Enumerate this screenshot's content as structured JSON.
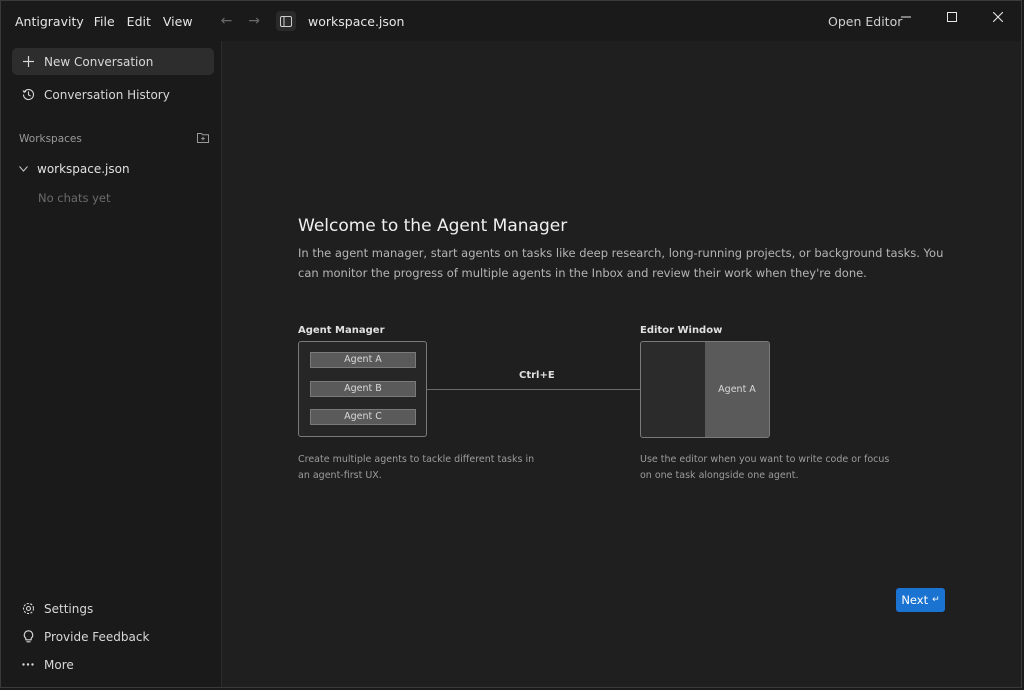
{
  "titlebar": {
    "app_name": "Antigravity",
    "menu": [
      "File",
      "Edit",
      "View"
    ],
    "title": "workspace.json",
    "open_editor": "Open Editor",
    "back_icon": "←",
    "forward_icon": "→"
  },
  "sidebar": {
    "new_conversation": "New Conversation",
    "conversation_history": "Conversation History",
    "workspaces_label": "Workspaces",
    "workspace_name": "workspace.json",
    "no_chats": "No chats yet",
    "settings": "Settings",
    "feedback": "Provide Feedback",
    "more": "More"
  },
  "main": {
    "title": "Welcome to the Agent Manager",
    "description": "In the agent manager, start agents on tasks like deep research, long-running projects, or background tasks. You can monitor the progress of multiple agents in the Inbox and review their work when they're done.",
    "manager_label": "Agent Manager",
    "agents": [
      "Agent A",
      "Agent B",
      "Agent C"
    ],
    "shortcut": "Ctrl+E",
    "editor_label": "Editor Window",
    "editor_agent": "Agent A",
    "manager_caption": "Create multiple agents to tackle different tasks in an agent-first UX.",
    "editor_caption": "Use the editor when you want to write code or focus on one task alongside one agent.",
    "next_label": "Next",
    "next_icon": "↵"
  },
  "colors": {
    "accent": "#1a73d1",
    "background": "#1f1f1f",
    "sidebar": "#1a1a1a"
  }
}
